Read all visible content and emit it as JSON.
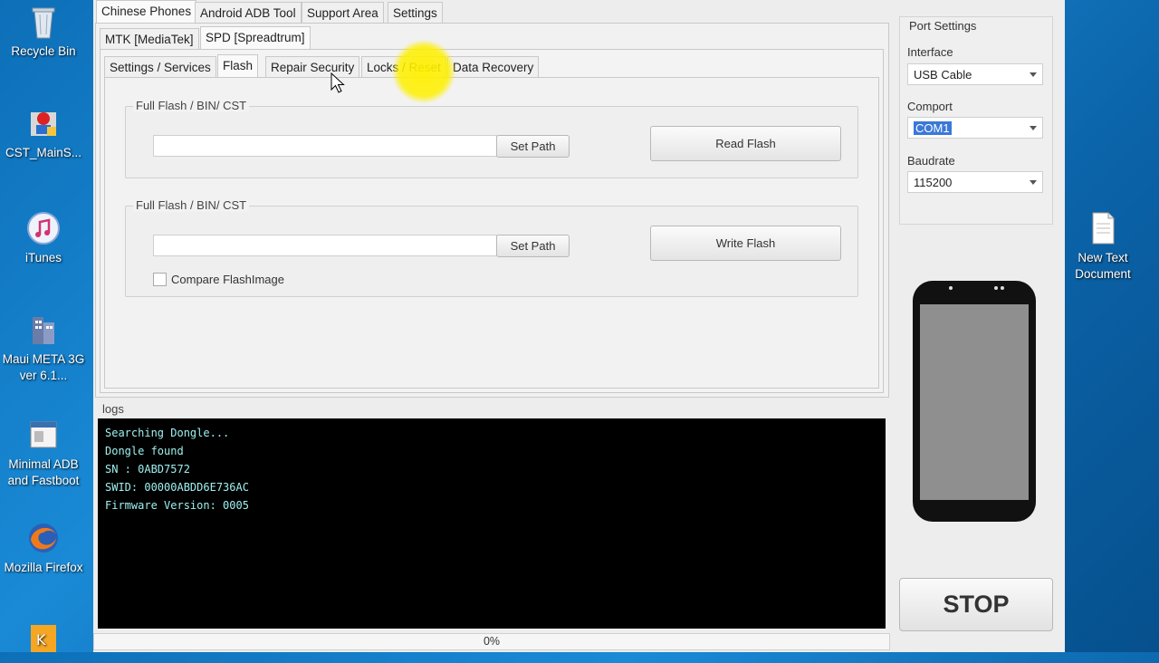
{
  "desktop": {
    "icons": [
      {
        "label": "Recycle Bin"
      },
      {
        "label": "CST_MainS..."
      },
      {
        "label": "iTunes"
      },
      {
        "label": "Maui META 3G ver 6.1..."
      },
      {
        "label": "Minimal ADB and Fastboot"
      },
      {
        "label": "Mozilla Firefox"
      },
      {
        "label": "New Text Document"
      }
    ]
  },
  "main_tabs": [
    "Chinese Phones",
    "Android ADB Tool",
    "Support Area",
    "Settings"
  ],
  "sub_tabs": [
    "MTK [MediaTek]",
    "SPD [Spreadtrum]"
  ],
  "inner_tabs": [
    "Settings / Services",
    "Flash",
    "Repair Security",
    "Locks / Reset",
    "Data Recovery"
  ],
  "flash": {
    "read_group": {
      "title": "Full Flash / BIN/ CST",
      "path_value": "",
      "set_path": "Set Path",
      "action": "Read Flash"
    },
    "write_group": {
      "title": "Full Flash / BIN/ CST",
      "path_value": "",
      "set_path": "Set Path",
      "action": "Write Flash",
      "compare_label": "Compare FlashImage"
    }
  },
  "logs": {
    "title": "logs",
    "lines": [
      "Searching Dongle...",
      "Dongle found",
      "SN  : 0ABD7572",
      "SWID: 00000ABDD6E736AC",
      "Firmware Version: 0005"
    ]
  },
  "progress": {
    "value": 0,
    "text": "0%"
  },
  "port_settings": {
    "title": "Port Settings",
    "interface_label": "Interface",
    "interface_value": "USB Cable",
    "comport_label": "Comport",
    "comport_value": "COM1",
    "baudrate_label": "Baudrate",
    "baudrate_value": "115200"
  },
  "stop_label": "STOP",
  "colors": {
    "log_bg": "#000000",
    "log_text": "#9ff0f0",
    "selection": "#3b78d8",
    "cursor_highlight": "#fff000"
  }
}
